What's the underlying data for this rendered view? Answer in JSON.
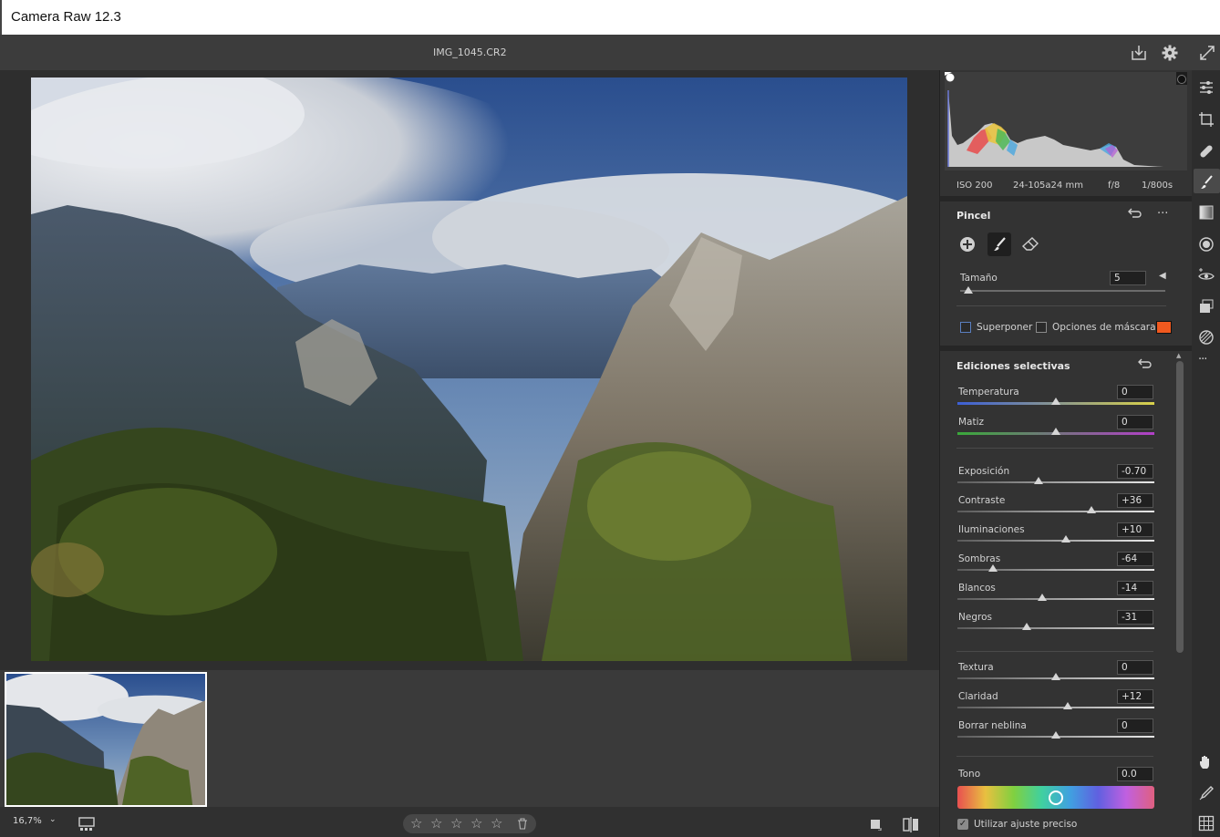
{
  "window": {
    "title": "Camera Raw 12.3"
  },
  "toolbar": {
    "filename": "IMG_1045.CR2",
    "icons": [
      "save-icon",
      "settings-gear-icon",
      "fullscreen-icon"
    ]
  },
  "image": {
    "description_icon": "mountain-landscape-photo"
  },
  "status": {
    "zoom": "16,7%",
    "star_count": 5,
    "stars": [
      "☆",
      "☆",
      "☆",
      "☆",
      "☆"
    ]
  },
  "exif": {
    "iso": "ISO 200",
    "lens": "24-105a24 mm",
    "aperture": "f/8",
    "shutter": "1/800s"
  },
  "brush": {
    "title": "Pincel",
    "size_label": "Tamaño",
    "size_value": "5",
    "overlay_label": "Superponer",
    "mask_options_label": "Opciones de máscara",
    "mask_color": "#f0591f"
  },
  "selective": {
    "title": "Ediciones selectivas",
    "sliders": [
      {
        "label": "Temperatura",
        "value": "0",
        "fraction": 0.5
      },
      {
        "label": "Matiz",
        "value": "0",
        "fraction": 0.5
      },
      {
        "label": "Exposición",
        "value": "-0.70",
        "fraction": 0.41
      },
      {
        "label": "Contraste",
        "value": "+36",
        "fraction": 0.68
      },
      {
        "label": "Iluminaciones",
        "value": "+10",
        "fraction": 0.55
      },
      {
        "label": "Sombras",
        "value": "-64",
        "fraction": 0.18
      },
      {
        "label": "Blancos",
        "value": "-14",
        "fraction": 0.43
      },
      {
        "label": "Negros",
        "value": "-31",
        "fraction": 0.35
      },
      {
        "label": "Textura",
        "value": "0",
        "fraction": 0.5
      },
      {
        "label": "Claridad",
        "value": "+12",
        "fraction": 0.56
      },
      {
        "label": "Borrar neblina",
        "value": "0",
        "fraction": 0.5
      }
    ],
    "tone_label": "Tono",
    "tone_value": "0.0",
    "tone_fraction": 0.5,
    "precise_label": "Utilizar ajuste preciso",
    "precise_checked": true
  },
  "colors": {
    "accent_ring": "#ffffff",
    "panel": "#333333"
  }
}
